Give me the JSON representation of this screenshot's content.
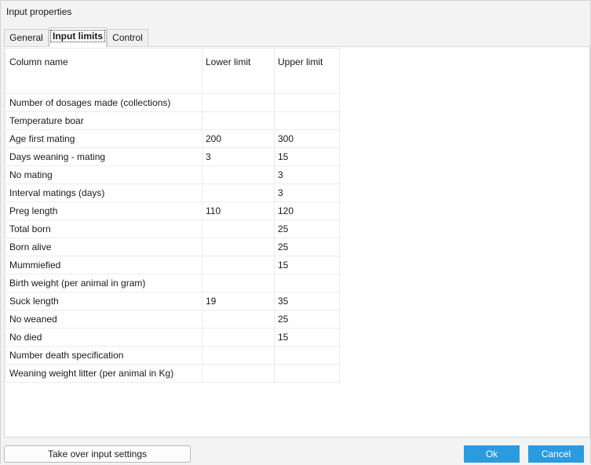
{
  "window": {
    "title": "Input properties"
  },
  "tabs": [
    {
      "label": "General",
      "active": false
    },
    {
      "label": "Input limits",
      "active": true
    },
    {
      "label": "Control",
      "active": false
    }
  ],
  "table": {
    "headers": [
      "Column name",
      "Lower limit",
      "Upper limit"
    ],
    "rows": [
      {
        "name": "Number of dosages made (collections)",
        "lower": "",
        "upper": ""
      },
      {
        "name": "Temperature boar",
        "lower": "",
        "upper": ""
      },
      {
        "name": "Age first mating",
        "lower": "200",
        "upper": "300"
      },
      {
        "name": "Days weaning - mating",
        "lower": "3",
        "upper": "15"
      },
      {
        "name": "No mating",
        "lower": "",
        "upper": "3"
      },
      {
        "name": "Interval matings (days)",
        "lower": "",
        "upper": "3"
      },
      {
        "name": "Preg length",
        "lower": "110",
        "upper": "120"
      },
      {
        "name": "Total born",
        "lower": "",
        "upper": "25"
      },
      {
        "name": "Born alive",
        "lower": "",
        "upper": "25"
      },
      {
        "name": "Mummiefied",
        "lower": "",
        "upper": "15"
      },
      {
        "name": "Birth weight (per animal in gram)",
        "lower": "",
        "upper": ""
      },
      {
        "name": "Suck length",
        "lower": "19",
        "upper": "35"
      },
      {
        "name": "No weaned",
        "lower": "",
        "upper": "25"
      },
      {
        "name": "No died",
        "lower": "",
        "upper": "15"
      },
      {
        "name": "Number death specification",
        "lower": "",
        "upper": ""
      },
      {
        "name": "Weaning weight litter (per animal in Kg)",
        "lower": "",
        "upper": ""
      }
    ]
  },
  "buttons": {
    "take_over": "Take over input settings",
    "ok": "Ok",
    "cancel": "Cancel"
  },
  "colors": {
    "primary_button": "#2b9be0",
    "dialog_background": "#f3f3f3"
  }
}
